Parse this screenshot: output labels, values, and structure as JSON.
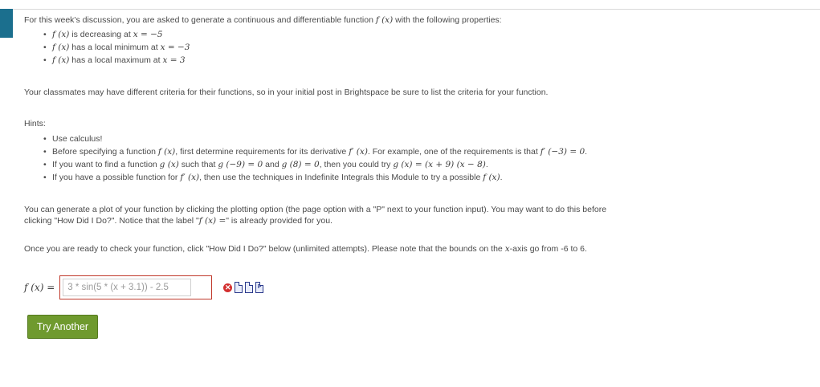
{
  "intro": {
    "text": "For this week's discussion, you are asked to generate a continuous and differentiable function",
    "func": "f (x)",
    "tail": "with the following properties:"
  },
  "properties": [
    {
      "math": "f (x)",
      "text": "is decreasing at",
      "cond": "x = −5"
    },
    {
      "math": "f (x)",
      "text": "has a local minimum at",
      "cond": "x = −3"
    },
    {
      "math": "f (x)",
      "text": "has a local maximum at",
      "cond": "x = 3"
    }
  ],
  "criteria_note": "Your classmates may have different criteria for their functions, so in your initial post in Brightspace be sure to list the criteria for your function.",
  "hints": {
    "heading": "Hints:",
    "h1": "Use calculus!",
    "h2a": "Before specifying a function",
    "h2m1": "f (x)",
    "h2b": ", first determine requirements for its derivative",
    "h2m2": "f′ (x)",
    "h2c": ". For example, one of the requirements is that",
    "h2m3": "f′ (−3) = 0",
    "h2d": ".",
    "h3a": "If you want to find a function",
    "h3m1": "g (x)",
    "h3b": "such that",
    "h3m2": "g (−9) = 0",
    "h3c": "and",
    "h3m3": "g (8) = 0",
    "h3d": ", then you could try",
    "h3m4": "g (x) = (x + 9) (x − 8)",
    "h3e": ".",
    "h4a": "If you have a possible function for",
    "h4m1": "f′ (x)",
    "h4b": ", then use the techniques in Indefinite Integrals this Module to try a possible",
    "h4m2": "f (x)",
    "h4c": "."
  },
  "plot_note": {
    "a": "You can generate a plot of your function by clicking the plotting option (the page option with a \"P\" next to your function input). You may want to do this before clicking \"How Did I Do?\". Notice that the label \"",
    "m": "f (x) =",
    "b": "\" is already provided for you."
  },
  "check_note": {
    "a": "Once you are ready to check your function, click \"How Did I Do?\" below (unlimited attempts). Please note that the bounds on the",
    "m": "x",
    "b": "-axis go from -6 to 6."
  },
  "answer": {
    "label": "f (x) =",
    "value": "3 * sin(5 * (x + 3.1)) - 2.5",
    "status_icon": "incorrect-x-icon",
    "icons": [
      "page-icon",
      "page-icon",
      "plot-page-icon"
    ],
    "icon_glyphs": [
      "",
      "",
      "P"
    ]
  },
  "button": {
    "label": "Try Another"
  },
  "colors": {
    "accent": "#1b6f8e",
    "button": "#6f9a2e",
    "error": "#c0392b"
  }
}
